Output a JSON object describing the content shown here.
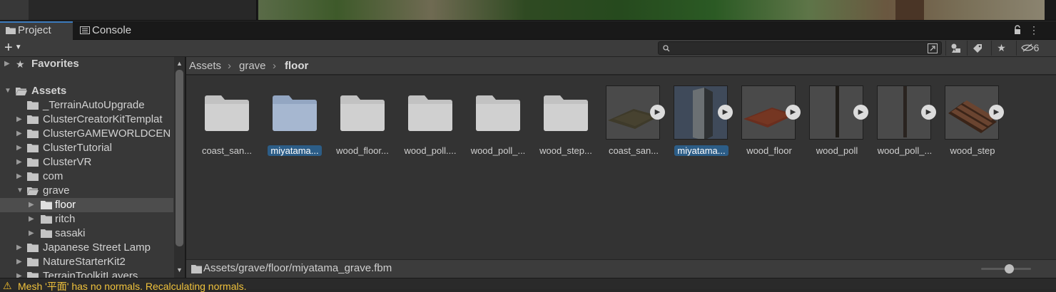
{
  "tabs": [
    {
      "label": "Project",
      "icon": "folder-icon",
      "active": true
    },
    {
      "label": "Console",
      "icon": "console-icon",
      "active": false
    }
  ],
  "toolbar": {
    "add_label": "+",
    "search_placeholder": "",
    "hidden_count": "6"
  },
  "tree": {
    "favorites": "Favorites",
    "assets": "Assets",
    "items": [
      {
        "label": "_TerrainAutoUpgrade"
      },
      {
        "label": "ClusterCreatorKitTemplat"
      },
      {
        "label": "ClusterGAMEWORLDCEN"
      },
      {
        "label": "ClusterTutorial"
      },
      {
        "label": "ClusterVR"
      },
      {
        "label": "com"
      },
      {
        "label": "grave"
      },
      {
        "label": "floor"
      },
      {
        "label": "ritch"
      },
      {
        "label": "sasaki"
      },
      {
        "label": "Japanese Street Lamp"
      },
      {
        "label": "NatureStarterKit2"
      },
      {
        "label": "TerrainToolkitLayers"
      }
    ]
  },
  "breadcrumb": [
    "Assets",
    "grave",
    "floor"
  ],
  "assets": [
    {
      "label": "coast_san...",
      "type": "folder",
      "selected": false
    },
    {
      "label": "miyatama...",
      "type": "folder",
      "selected": true
    },
    {
      "label": "wood_floor...",
      "type": "folder",
      "selected": false
    },
    {
      "label": "wood_poll....",
      "type": "folder",
      "selected": false
    },
    {
      "label": "wood_poll_...",
      "type": "folder",
      "selected": false
    },
    {
      "label": "wood_step...",
      "type": "folder",
      "selected": false
    },
    {
      "label": "coast_san...",
      "type": "mesh",
      "selected": false
    },
    {
      "label": "miyatama...",
      "type": "mesh",
      "selected": true
    },
    {
      "label": "wood_floor",
      "type": "mesh",
      "selected": false
    },
    {
      "label": "wood_poll",
      "type": "mesh",
      "selected": false
    },
    {
      "label": "wood_poll_...",
      "type": "mesh",
      "selected": false
    },
    {
      "label": "wood_step",
      "type": "mesh",
      "selected": false
    }
  ],
  "status": {
    "path": "Assets/grave/floor/miyatama_grave.fbm",
    "console_message": "Mesh '平面' has no normals. Recalculating normals."
  },
  "colors": {
    "selection": "#2c5d87",
    "active_tab_accent": "#3a79bb",
    "warning": "#f4bf2a"
  }
}
